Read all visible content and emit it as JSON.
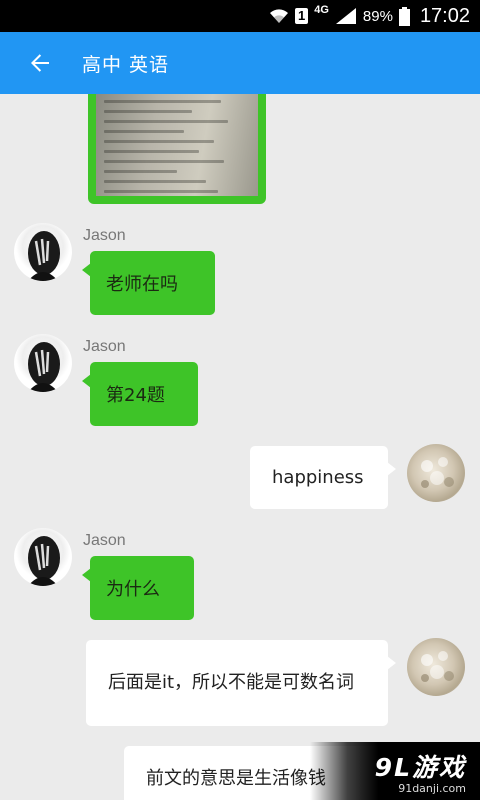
{
  "status_bar": {
    "sim_slot": "1",
    "network": "4G",
    "battery": "89%",
    "time": "17:02"
  },
  "app_bar": {
    "title": "高中 英语",
    "back_icon": "arrow-left-icon"
  },
  "messages": [
    {
      "type": "image",
      "direction": "in"
    },
    {
      "type": "text",
      "direction": "in",
      "sender": "Jason",
      "text": "老师在吗"
    },
    {
      "type": "text",
      "direction": "in",
      "sender": "Jason",
      "text": "第24题"
    },
    {
      "type": "text",
      "direction": "out",
      "text": "happiness"
    },
    {
      "type": "text",
      "direction": "in",
      "sender": "Jason",
      "text": "为什么"
    },
    {
      "type": "text",
      "direction": "out",
      "text": "后面是it，所以不能是可数名词"
    },
    {
      "type": "text",
      "direction": "out",
      "text": "前文的意思是生活像钱"
    }
  ],
  "watermark": {
    "main": "9L游戏",
    "sub": "91danji.com"
  },
  "colors": {
    "app_bar": "#2196f3",
    "incoming_bubble": "#3ec428",
    "outgoing_bubble": "#ffffff",
    "background": "#ebebeb"
  }
}
